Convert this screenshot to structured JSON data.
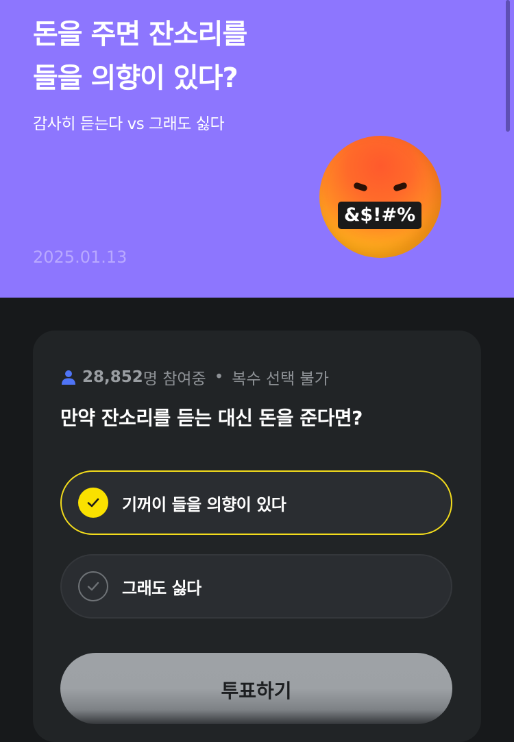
{
  "hero": {
    "title_line1": "돈을 주면 잔소리를",
    "title_line2": "들을 의향이 있다?",
    "subtitle": "감사히 듣는다 vs 그래도 싫다",
    "date": "2025.01.13",
    "emoji_text": "&$!#%",
    "background": "#8d76fe"
  },
  "poll": {
    "participant_count": "28,852",
    "participant_suffix": "명 참여중",
    "separator": "•",
    "selection_mode": "복수 선택 불가",
    "question": "만약 잔소리를 듣는 대신 돈을 준다면?",
    "options": [
      {
        "label": "기꺼이 들을 의향이 있다",
        "selected": true
      },
      {
        "label": "그래도 싫다",
        "selected": false
      }
    ],
    "vote_button": "투표하기",
    "accent": "#fae100"
  }
}
